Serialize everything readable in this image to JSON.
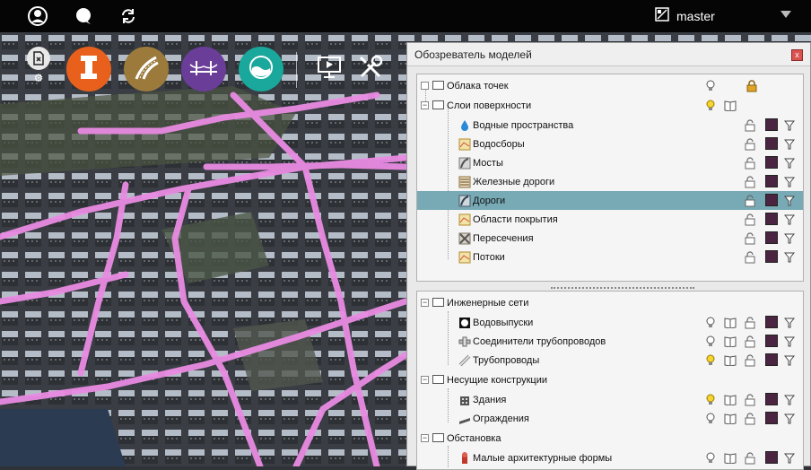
{
  "topbar": {
    "icons": [
      "user-icon",
      "chat-icon",
      "sync-icon"
    ],
    "branch_label": "master",
    "branch_icon": "branch-icon"
  },
  "toolbar": {
    "buttons": [
      {
        "name": "file-settings-icon",
        "color": "#e8e8e8"
      },
      {
        "name": "pipe-icon",
        "color": "#e8601c"
      },
      {
        "name": "road-icon",
        "color": "#9b7a3c"
      },
      {
        "name": "bridge-icon",
        "color": "#6a3d99"
      },
      {
        "name": "water-icon",
        "color": "#1aa79c"
      },
      {
        "name": "presentation-icon",
        "color": "#ffffff"
      },
      {
        "name": "tools-icon",
        "color": "#ffffff"
      }
    ]
  },
  "panel": {
    "title": "Обозреватель моделей",
    "close_label": "x",
    "top_tree": [
      {
        "label": "Облака точек",
        "level": 0,
        "icons": [
          "bulb-off",
          "lock-gold"
        ]
      },
      {
        "label": "Слои поверхности",
        "level": 0,
        "icons": [
          "bulb-on",
          "book"
        ]
      },
      {
        "label": "Водные пространства",
        "level": 1,
        "icon": "water-drop-icon"
      },
      {
        "label": "Водосборы",
        "level": 1,
        "icon": "map-icon"
      },
      {
        "label": "Мосты",
        "level": 1,
        "icon": "bridge-layer-icon"
      },
      {
        "label": "Железные дороги",
        "level": 1,
        "icon": "railway-icon"
      },
      {
        "label": "Дороги",
        "level": 1,
        "icon": "road-layer-icon",
        "selected": true
      },
      {
        "label": "Области покрытия",
        "level": 1,
        "icon": "map-icon"
      },
      {
        "label": "Пересечения",
        "level": 1,
        "icon": "intersection-icon"
      },
      {
        "label": "Потоки",
        "level": 1,
        "icon": "map-icon"
      }
    ],
    "bottom_tree": [
      {
        "label": "Инженерные сети",
        "level": 0
      },
      {
        "label": "Водовыпуски",
        "level": 1,
        "icon": "outlet-icon"
      },
      {
        "label": "Соединители трубопроводов",
        "level": 1,
        "icon": "connector-icon"
      },
      {
        "label": "Трубопроводы",
        "level": 1,
        "icon": "pipe-layer-icon"
      },
      {
        "label": "Несущие конструкции",
        "level": 0
      },
      {
        "label": "Здания",
        "level": 1,
        "icon": "building-icon"
      },
      {
        "label": "Ограждения",
        "level": 1,
        "icon": "fence-icon"
      },
      {
        "label": "Обстановка",
        "level": 0
      },
      {
        "label": "Малые архитектурные формы",
        "level": 1,
        "icon": "hydrant-icon"
      }
    ]
  },
  "colors": {
    "road": "#e98be3",
    "selection": "#77aab5",
    "swatch": "#4a2440"
  }
}
